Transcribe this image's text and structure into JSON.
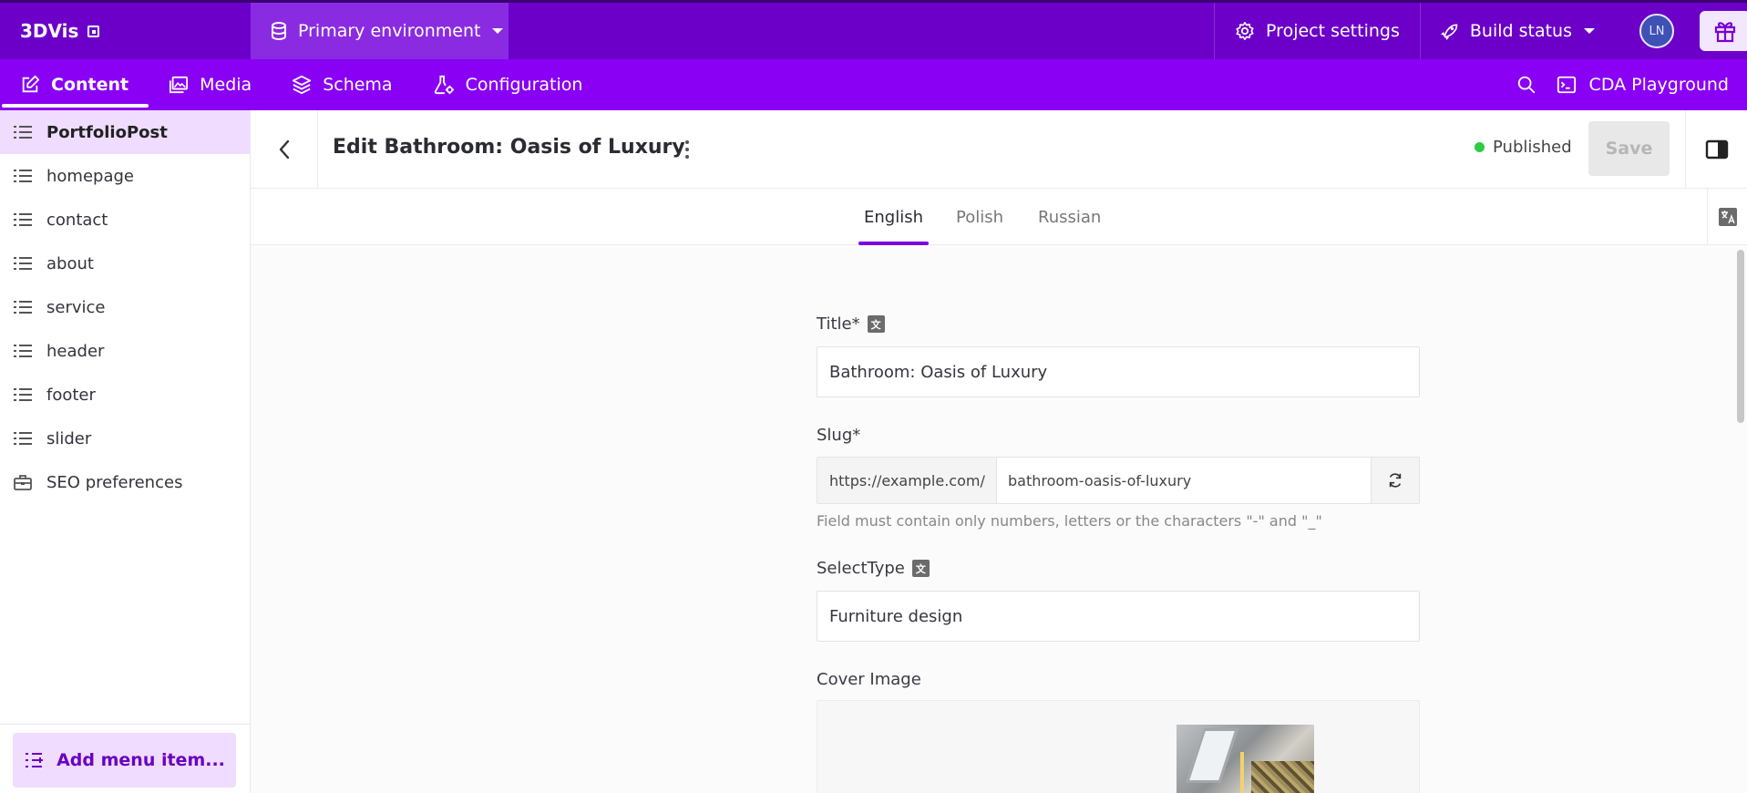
{
  "topbar": {
    "brand": "3DVis",
    "environment": "Primary environment",
    "project_settings": "Project settings",
    "build_status": "Build status",
    "avatar_initials": "LN"
  },
  "navbar": {
    "tabs": [
      {
        "label": "Content",
        "icon": "edit-icon",
        "active": true
      },
      {
        "label": "Media",
        "icon": "image-icon"
      },
      {
        "label": "Schema",
        "icon": "layers-icon"
      },
      {
        "label": "Configuration",
        "icon": "flask-gear-icon"
      }
    ],
    "cda_playground": "CDA Playground"
  },
  "sidebar": {
    "items": [
      {
        "label": "PortfolioPost",
        "icon": "list-icon",
        "active": true
      },
      {
        "label": "homepage",
        "icon": "list-icon"
      },
      {
        "label": "contact",
        "icon": "list-icon"
      },
      {
        "label": "about",
        "icon": "list-icon"
      },
      {
        "label": "service",
        "icon": "list-icon"
      },
      {
        "label": "header",
        "icon": "list-icon"
      },
      {
        "label": "footer",
        "icon": "list-icon"
      },
      {
        "label": "slider",
        "icon": "list-icon"
      },
      {
        "label": "SEO preferences",
        "icon": "toolbox-icon"
      }
    ],
    "add_menu_item": "Add menu item..."
  },
  "header": {
    "title": "Edit Bathroom: Oasis of Luxury",
    "status": "Published",
    "save_label": "Save"
  },
  "locales": {
    "tabs": [
      "English",
      "Polish",
      "Russian"
    ],
    "active": "English"
  },
  "form": {
    "title_label": "Title*",
    "title_value": "Bathroom: Oasis of Luxury",
    "slug_label": "Slug*",
    "slug_prefix": "https://example.com/",
    "slug_value": "bathroom-oasis-of-luxury",
    "slug_hint": "Field must contain only numbers, letters or the characters \"-\" and \"_\"",
    "select_type_label": "SelectType",
    "select_type_value": "Furniture design",
    "cover_image_label": "Cover Image"
  },
  "colors": {
    "topbar": "#6c00c9",
    "navbar": "#8a00f5",
    "accent": "#7d00e0",
    "sidebar_active": "#efdcff",
    "published_dot": "#2ecc40"
  }
}
